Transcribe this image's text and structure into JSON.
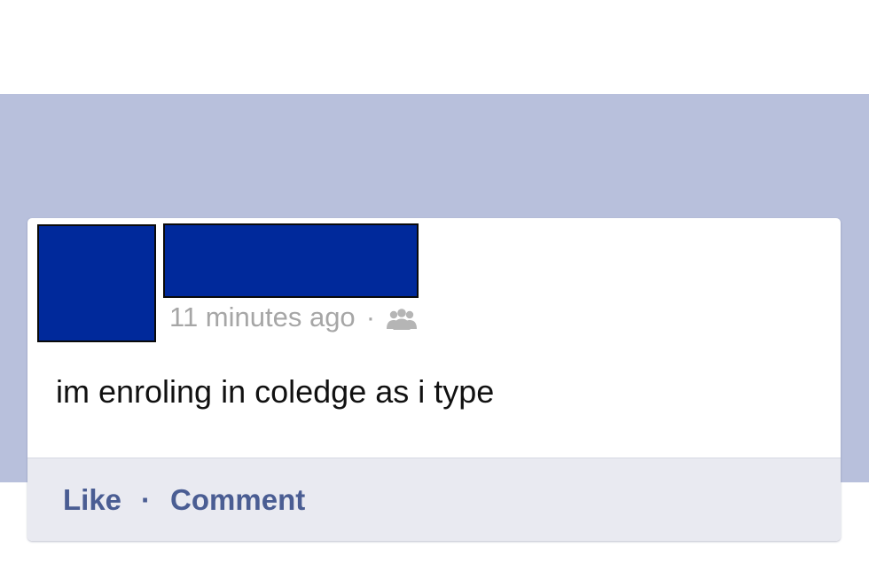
{
  "post": {
    "timestamp": "11 minutes ago",
    "meta_separator": "·",
    "audience_icon": "friends-icon",
    "text": "im enroling in coledge as i type",
    "actions": {
      "like_label": "Like",
      "separator": "·",
      "comment_label": "Comment"
    }
  },
  "colors": {
    "band_background": "#b8c0dc",
    "redaction_fill": "#00299b",
    "action_link": "#4a5d93",
    "timestamp_gray": "#a6a6a6"
  }
}
